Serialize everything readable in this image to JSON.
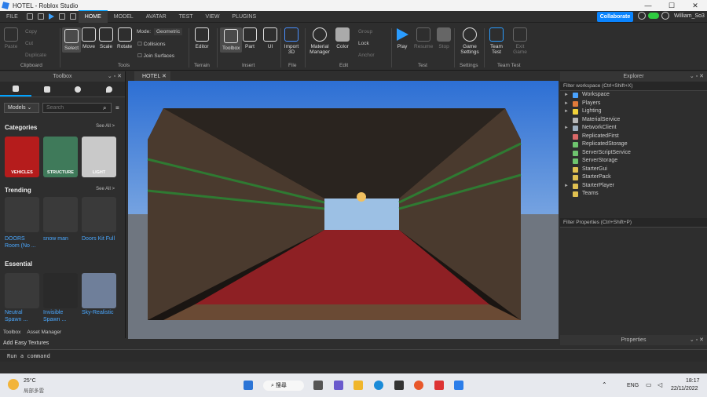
{
  "window": {
    "title": "HOTEL - Roblox Studio"
  },
  "menu": {
    "file": "FILE",
    "tabs": [
      "HOME",
      "MODEL",
      "AVATAR",
      "TEST",
      "VIEW",
      "PLUGINS"
    ],
    "collaborate": "Collaborate",
    "user": "William_So3"
  },
  "ribbon": {
    "clipboard": {
      "paste": "Paste",
      "copy": "Copy",
      "cut": "Cut",
      "duplicate": "Duplicate",
      "group": "Clipboard"
    },
    "tools": {
      "select": "Select",
      "move": "Move",
      "scale": "Scale",
      "rotate": "Rotate",
      "mode_label": "Mode:",
      "mode_value": "Geometric",
      "collisions": "Collisions",
      "join_surfaces": "Join Surfaces",
      "group": "Tools"
    },
    "terrain": {
      "editor": "Editor",
      "group": "Terrain"
    },
    "insert": {
      "toolbox": "Toolbox",
      "part": "Part",
      "ui": "UI",
      "group": "Insert"
    },
    "file": {
      "import3d": "Import 3D",
      "group": "File"
    },
    "edit": {
      "material": "Material Manager",
      "color": "Color",
      "group_btn": "Group",
      "lock": "Lock",
      "anchor": "Anchor",
      "group": "Edit"
    },
    "test": {
      "play": "Play",
      "resume": "Resume",
      "stop": "Stop",
      "group": "Test"
    },
    "settings": {
      "game": "Game Settings",
      "group": "Settings"
    },
    "teamtest": {
      "team": "Team Test",
      "exit": "Exit Game",
      "group": "Team Test"
    }
  },
  "toolbox": {
    "title": "Toolbox",
    "dropdown": "Models",
    "search_placeholder": "Search",
    "categories_title": "Categories",
    "see_all": "See All >",
    "categories": [
      {
        "label": "VEHICLES",
        "color": "#b51c1c"
      },
      {
        "label": "STRUCTURE",
        "color": "#3f7a5a"
      },
      {
        "label": "LIGHT",
        "color": "#c9c9c9"
      }
    ],
    "trending_title": "Trending",
    "trending": [
      "DOORS Room (No ...",
      "snow man",
      "Doors Kit Full"
    ],
    "essential_title": "Essential",
    "essential": [
      "Neutral Spawn ...",
      "Invisible Spawn ...",
      "Sky-Realistic"
    ],
    "bottom_tabs": [
      "Toolbox",
      "Asset Manager"
    ],
    "plugin_label": "Add Easy Textures"
  },
  "viewport": {
    "tab": "HOTEL"
  },
  "explorer": {
    "title": "Explorer",
    "filter": "Filter workspace (Ctrl+Shift+X)",
    "items": [
      {
        "name": "Workspace",
        "arrow": "►",
        "color": "#4aa3ff"
      },
      {
        "name": "Players",
        "arrow": "►",
        "color": "#e07a3a"
      },
      {
        "name": "Lighting",
        "arrow": "►",
        "color": "#f2d23a"
      },
      {
        "name": "MaterialService",
        "arrow": "",
        "color": "#b8b8b8"
      },
      {
        "name": "NetworkClient",
        "arrow": "►",
        "color": "#9fb0c0"
      },
      {
        "name": "ReplicatedFirst",
        "arrow": "",
        "color": "#d96868"
      },
      {
        "name": "ReplicatedStorage",
        "arrow": "",
        "color": "#6ec46e"
      },
      {
        "name": "ServerScriptService",
        "arrow": "",
        "color": "#6ec46e"
      },
      {
        "name": "ServerStorage",
        "arrow": "",
        "color": "#6ec46e"
      },
      {
        "name": "StarterGui",
        "arrow": "",
        "color": "#e0c050"
      },
      {
        "name": "StarterPack",
        "arrow": "",
        "color": "#e0c050"
      },
      {
        "name": "StarterPlayer",
        "arrow": "►",
        "color": "#e0c050"
      },
      {
        "name": "Teams",
        "arrow": "",
        "color": "#e0c050"
      }
    ]
  },
  "properties": {
    "title": "Properties",
    "filter": "Filter Properties (Ctrl+Shift+P)"
  },
  "command": {
    "placeholder": "Run a command"
  },
  "taskbar": {
    "temp": "25°C",
    "weather": "局部多雲",
    "search": "搜尋",
    "lang": "ENG",
    "time": "18:17",
    "date": "22/11/2022"
  }
}
